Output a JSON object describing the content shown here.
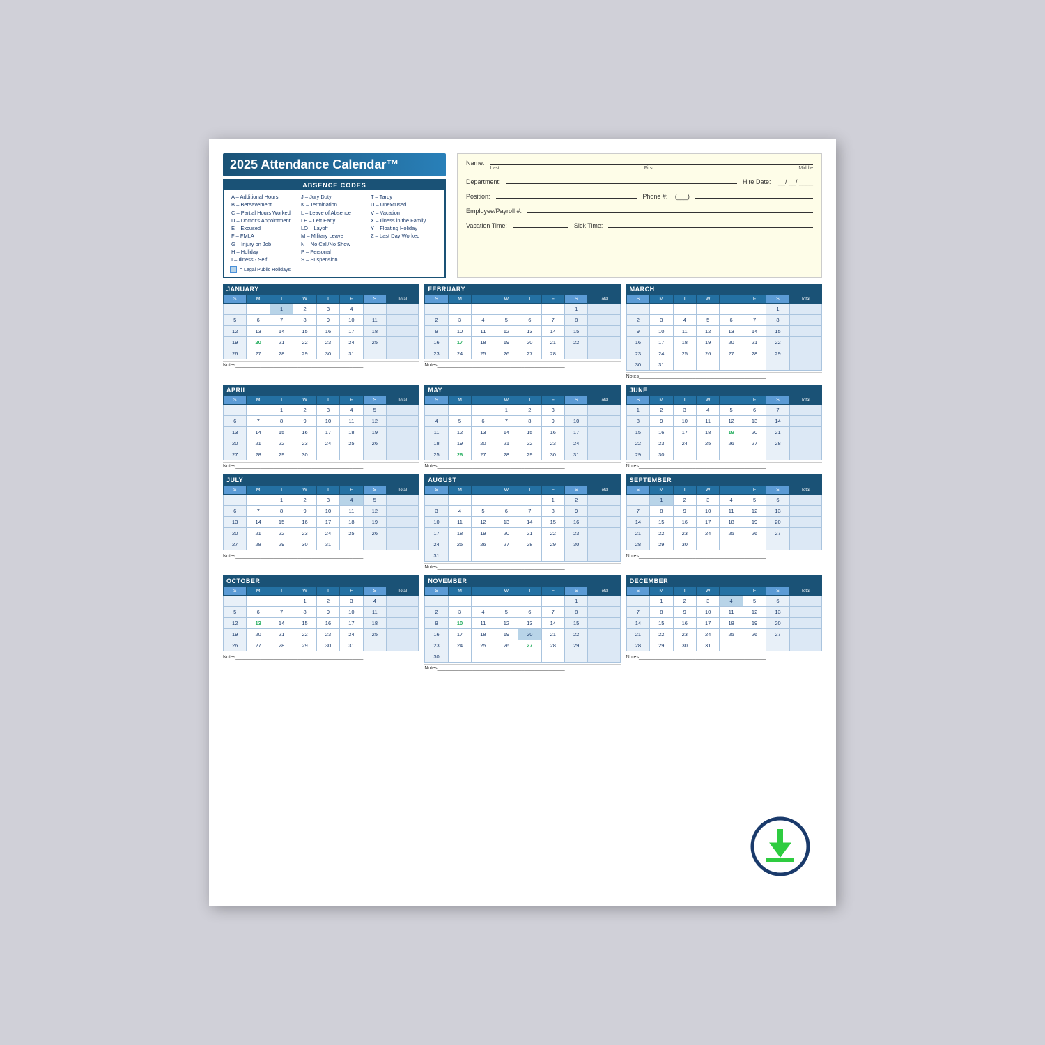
{
  "title": "2025 Attendance Calendar™",
  "absence_codes_header": "ABSENCE CODES",
  "codes": {
    "col1": [
      "A – Additional Hours",
      "B – Bereavement",
      "C – Partial Hours Worked",
      "D – Doctor's Appointment",
      "E – Excused",
      "F – FMLA",
      "G – Injury on Job",
      "H – Holiday",
      "I – Illness - Self"
    ],
    "col2": [
      "J – Jury Duty",
      "K – Termination",
      "L – Leave of Absence",
      "LE – Left Early",
      "LO – Layoff",
      "M – Military Leave",
      "N – No Call/No Show",
      "P – Personal",
      "S – Suspension"
    ],
    "col3": [
      "T – Tardy",
      "U – Unexcused",
      "V – Vacation",
      "X – Illness in the Family",
      "Y – Floating Holiday",
      "Z – Last Day Worked",
      "– –",
      "",
      ""
    ]
  },
  "holiday_note": "= Legal Public Holidays",
  "form": {
    "name_label": "Name:",
    "last_label": "Last",
    "first_label": "First",
    "middle_label": "Middle",
    "dept_label": "Department:",
    "hire_label": "Hire Date:",
    "position_label": "Position:",
    "phone_label": "Phone #:",
    "emp_label": "Employee/Payroll #:",
    "vacation_label": "Vacation Time:",
    "sick_label": "Sick Time:"
  },
  "months": [
    {
      "name": "JANUARY",
      "days": [
        [
          "",
          "",
          "1",
          "2",
          "3",
          "4",
          ""
        ],
        [
          "5",
          "6",
          "7",
          "8",
          "9",
          "10",
          "11"
        ],
        [
          "12",
          "13",
          "14",
          "15",
          "16",
          "17",
          "18"
        ],
        [
          "19",
          "20",
          "21",
          "22",
          "23",
          "24",
          "25"
        ],
        [
          "26",
          "27",
          "28",
          "29",
          "30",
          "31",
          ""
        ]
      ],
      "holidays": [
        {
          "row": 0,
          "col": 2
        }
      ],
      "green": [
        {
          "row": 3,
          "col": 1
        }
      ]
    },
    {
      "name": "FEBRUARY",
      "days": [
        [
          "",
          "",
          "",
          "",
          "",
          "",
          "1"
        ],
        [
          "2",
          "3",
          "4",
          "5",
          "6",
          "7",
          "8"
        ],
        [
          "9",
          "10",
          "11",
          "12",
          "13",
          "14",
          "15"
        ],
        [
          "16",
          "17",
          "18",
          "19",
          "20",
          "21",
          "22"
        ],
        [
          "23",
          "24",
          "25",
          "26",
          "27",
          "28",
          ""
        ]
      ],
      "holidays": [],
      "green": [
        {
          "row": 3,
          "col": 1
        }
      ]
    },
    {
      "name": "MARCH",
      "days": [
        [
          "",
          "",
          "",
          "",
          "",
          "",
          "1"
        ],
        [
          "2",
          "3",
          "4",
          "5",
          "6",
          "7",
          "8"
        ],
        [
          "9",
          "10",
          "11",
          "12",
          "13",
          "14",
          "15"
        ],
        [
          "16",
          "17",
          "18",
          "19",
          "20",
          "21",
          "22"
        ],
        [
          "23",
          "24",
          "25",
          "26",
          "27",
          "28",
          "29"
        ],
        [
          "30",
          "31",
          "",
          "",
          "",
          "",
          ""
        ]
      ],
      "holidays": [],
      "green": []
    },
    {
      "name": "APRIL",
      "days": [
        [
          "",
          "",
          "1",
          "2",
          "3",
          "4",
          "5"
        ],
        [
          "6",
          "7",
          "8",
          "9",
          "10",
          "11",
          "12"
        ],
        [
          "13",
          "14",
          "15",
          "16",
          "17",
          "18",
          "19"
        ],
        [
          "20",
          "21",
          "22",
          "23",
          "24",
          "25",
          "26"
        ],
        [
          "27",
          "28",
          "29",
          "30",
          "",
          "",
          ""
        ]
      ],
      "holidays": [],
      "green": []
    },
    {
      "name": "MAY",
      "days": [
        [
          "",
          "",
          "",
          "1",
          "2",
          "3",
          ""
        ],
        [
          "4",
          "5",
          "6",
          "7",
          "8",
          "9",
          "10"
        ],
        [
          "11",
          "12",
          "13",
          "14",
          "15",
          "16",
          "17"
        ],
        [
          "18",
          "19",
          "20",
          "21",
          "22",
          "23",
          "24"
        ],
        [
          "25",
          "26",
          "27",
          "28",
          "29",
          "30",
          "31"
        ]
      ],
      "holidays": [],
      "green": [
        {
          "row": 4,
          "col": 1
        }
      ]
    },
    {
      "name": "JUNE",
      "days": [
        [
          "1",
          "2",
          "3",
          "4",
          "5",
          "6",
          "7"
        ],
        [
          "8",
          "9",
          "10",
          "11",
          "12",
          "13",
          "14"
        ],
        [
          "15",
          "16",
          "17",
          "18",
          "19",
          "20",
          "21"
        ],
        [
          "22",
          "23",
          "24",
          "25",
          "26",
          "27",
          "28"
        ],
        [
          "29",
          "30",
          "",
          "",
          "",
          "",
          ""
        ]
      ],
      "holidays": [],
      "green": [
        {
          "row": 2,
          "col": 4
        }
      ]
    },
    {
      "name": "JULY",
      "days": [
        [
          "",
          "",
          "1",
          "2",
          "3",
          "4",
          "5"
        ],
        [
          "6",
          "7",
          "8",
          "9",
          "10",
          "11",
          "12"
        ],
        [
          "13",
          "14",
          "15",
          "16",
          "17",
          "18",
          "19"
        ],
        [
          "20",
          "21",
          "22",
          "23",
          "24",
          "25",
          "26"
        ],
        [
          "27",
          "28",
          "29",
          "30",
          "31",
          "",
          ""
        ]
      ],
      "holidays": [
        {
          "row": 0,
          "col": 5
        }
      ],
      "green": []
    },
    {
      "name": "AUGUST",
      "days": [
        [
          "",
          "",
          "",
          "",
          "",
          "1",
          "2"
        ],
        [
          "3",
          "4",
          "5",
          "6",
          "7",
          "8",
          "9"
        ],
        [
          "10",
          "11",
          "12",
          "13",
          "14",
          "15",
          "16"
        ],
        [
          "17",
          "18",
          "19",
          "20",
          "21",
          "22",
          "23"
        ],
        [
          "24",
          "25",
          "26",
          "27",
          "28",
          "29",
          "30"
        ],
        [
          "31",
          "",
          "",
          "",
          "",
          "",
          ""
        ]
      ],
      "holidays": [],
      "green": []
    },
    {
      "name": "SEPTEMBER",
      "days": [
        [
          "",
          "1",
          "2",
          "3",
          "4",
          "5",
          "6"
        ],
        [
          "7",
          "8",
          "9",
          "10",
          "11",
          "12",
          "13"
        ],
        [
          "14",
          "15",
          "16",
          "17",
          "18",
          "19",
          "20"
        ],
        [
          "21",
          "22",
          "23",
          "24",
          "25",
          "26",
          "27"
        ],
        [
          "28",
          "29",
          "30",
          "",
          "",
          "",
          ""
        ]
      ],
      "holidays": [
        {
          "row": 0,
          "col": 1
        }
      ],
      "green": []
    },
    {
      "name": "OCTOBER",
      "days": [
        [
          "",
          "",
          "",
          "1",
          "2",
          "3",
          "4"
        ],
        [
          "5",
          "6",
          "7",
          "8",
          "9",
          "10",
          "11"
        ],
        [
          "12",
          "13",
          "14",
          "15",
          "16",
          "17",
          "18"
        ],
        [
          "19",
          "20",
          "21",
          "22",
          "23",
          "24",
          "25"
        ],
        [
          "26",
          "27",
          "28",
          "29",
          "30",
          "31",
          ""
        ]
      ],
      "holidays": [],
      "green": [
        {
          "row": 2,
          "col": 1
        }
      ]
    },
    {
      "name": "NOVEMBER",
      "days": [
        [
          "",
          "",
          "",
          "",
          "",
          "",
          "1"
        ],
        [
          "2",
          "3",
          "4",
          "5",
          "6",
          "7",
          "8"
        ],
        [
          "9",
          "10",
          "11",
          "12",
          "13",
          "14",
          "15"
        ],
        [
          "16",
          "17",
          "18",
          "19",
          "20",
          "21",
          "22"
        ],
        [
          "23",
          "24",
          "25",
          "26",
          "27",
          "28",
          "29"
        ],
        [
          "30",
          "",
          "",
          "",
          "",
          "",
          ""
        ]
      ],
      "holidays": [
        {
          "row": 3,
          "col": 4
        }
      ],
      "green": [
        {
          "row": 2,
          "col": 1
        },
        {
          "row": 4,
          "col": 4
        }
      ]
    },
    {
      "name": "DECEMBER",
      "days": [
        [
          "",
          "1",
          "2",
          "3",
          "4",
          "5",
          "6"
        ],
        [
          "7",
          "8",
          "9",
          "10",
          "11",
          "12",
          "13"
        ],
        [
          "14",
          "15",
          "16",
          "17",
          "18",
          "19",
          "20"
        ],
        [
          "21",
          "22",
          "23",
          "24",
          "25",
          "26",
          "27"
        ],
        [
          "28",
          "29",
          "30",
          "31",
          "",
          "",
          ""
        ]
      ],
      "holidays": [
        {
          "row": 0,
          "col": 4
        }
      ],
      "green": []
    }
  ],
  "notes_label": "Notes",
  "days_header": [
    "S",
    "M",
    "T",
    "W",
    "T",
    "F",
    "S",
    "Total"
  ]
}
